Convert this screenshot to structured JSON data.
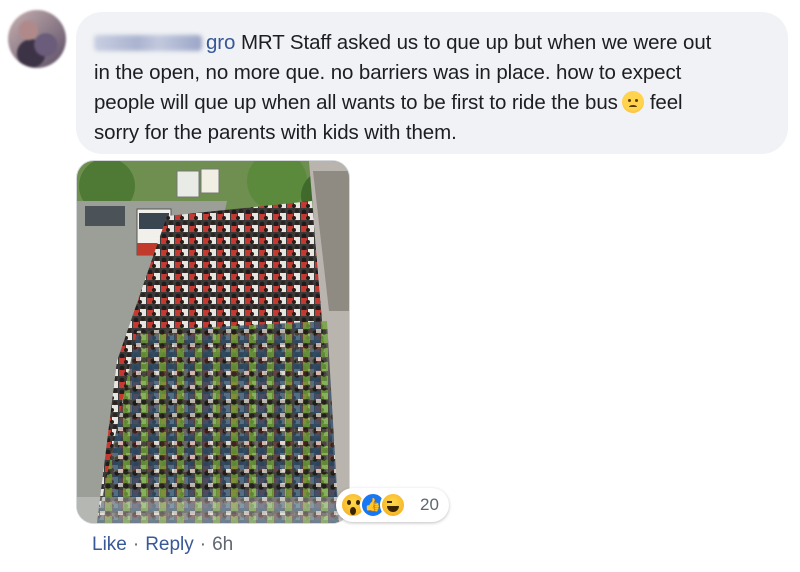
{
  "comment": {
    "author_name_tail": "gro",
    "text_line1": " MRT Staff asked us to que up but when we were out",
    "text_line2": "in the open, no more que. no barriers was in place. how to expect",
    "text_line3": "people will que up when all wants to be first to ride the bus",
    "text_line3_after_emoji": "feel",
    "text_line4": "sorry for the parents with kids with them.",
    "emoji_icon": "frowning-face-emoji"
  },
  "reactions": {
    "icons": [
      "wow-reaction-icon",
      "like-reaction-icon",
      "haha-reaction-icon"
    ],
    "count": "20"
  },
  "actions": {
    "like_label": "Like",
    "separator": "·",
    "reply_label": "Reply",
    "timestamp": "6h"
  },
  "colors": {
    "link_blue": "#385898",
    "bubble_bg": "#f0f2f5",
    "like_blue": "#1877f2"
  }
}
